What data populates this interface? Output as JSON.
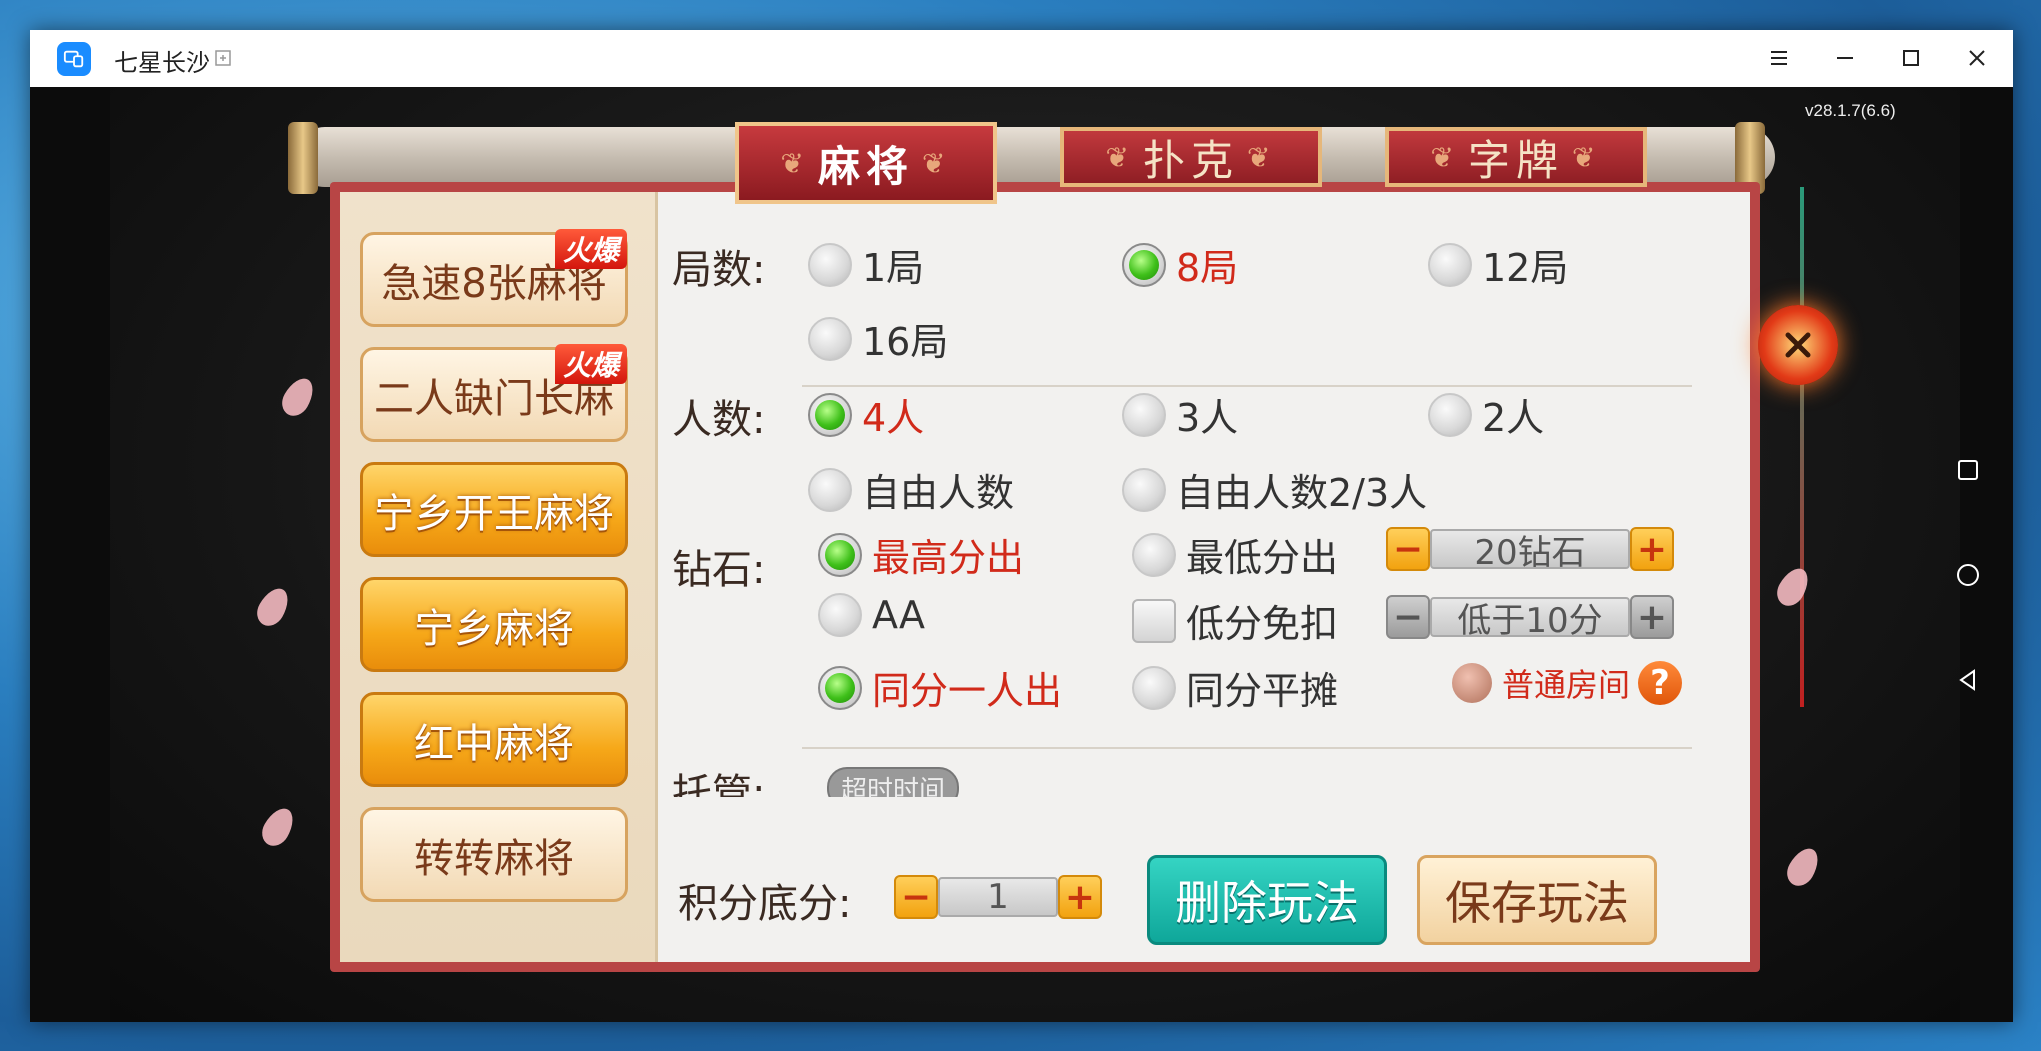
{
  "window": {
    "title": "七星长沙"
  },
  "version": "v28.1.7(6.6)",
  "tabs": [
    {
      "label": "麻将",
      "active": true
    },
    {
      "label": "扑克",
      "active": false
    },
    {
      "label": "字牌",
      "active": false
    }
  ],
  "games": [
    {
      "label": "急速8张麻将",
      "badge": "火爆",
      "style": "pale"
    },
    {
      "label": "二人缺门长麻",
      "badge": "火爆",
      "style": "pale"
    },
    {
      "label": "宁乡开王麻将",
      "badge": "",
      "style": "gold"
    },
    {
      "label": "宁乡麻将",
      "badge": "",
      "style": "gold"
    },
    {
      "label": "红中麻将",
      "badge": "",
      "style": "gold"
    },
    {
      "label": "转转麻将",
      "badge": "",
      "style": "pale"
    }
  ],
  "rounds": {
    "label": "局数:",
    "options": [
      "1局",
      "8局",
      "12局",
      "16局"
    ],
    "selected": "8局"
  },
  "players": {
    "label": "人数:",
    "options": [
      "4人",
      "3人",
      "2人",
      "自由人数",
      "自由人数2/3人"
    ],
    "selected": "4人"
  },
  "diamonds": {
    "label": "钻石:",
    "options": [
      "最高分出",
      "最低分出",
      "AA",
      "同分一人出",
      "同分平摊"
    ],
    "checkbox_label": "低分免扣",
    "stepper1_value": "20钻石",
    "stepper2_value": "低于10分",
    "room_type": "普通房间",
    "help": "?"
  },
  "trustee": {
    "label": "托管:",
    "pill": "超时时间"
  },
  "base_score": {
    "label": "积分底分:",
    "value": "1"
  },
  "buttons": {
    "delete": "删除玩法",
    "save": "保存玩法"
  },
  "colors": {
    "selected_text": "#d12a1a",
    "tab_red": "#a8282d",
    "teal_button": "#1fb8aa",
    "gold_button": "#f6a819"
  }
}
